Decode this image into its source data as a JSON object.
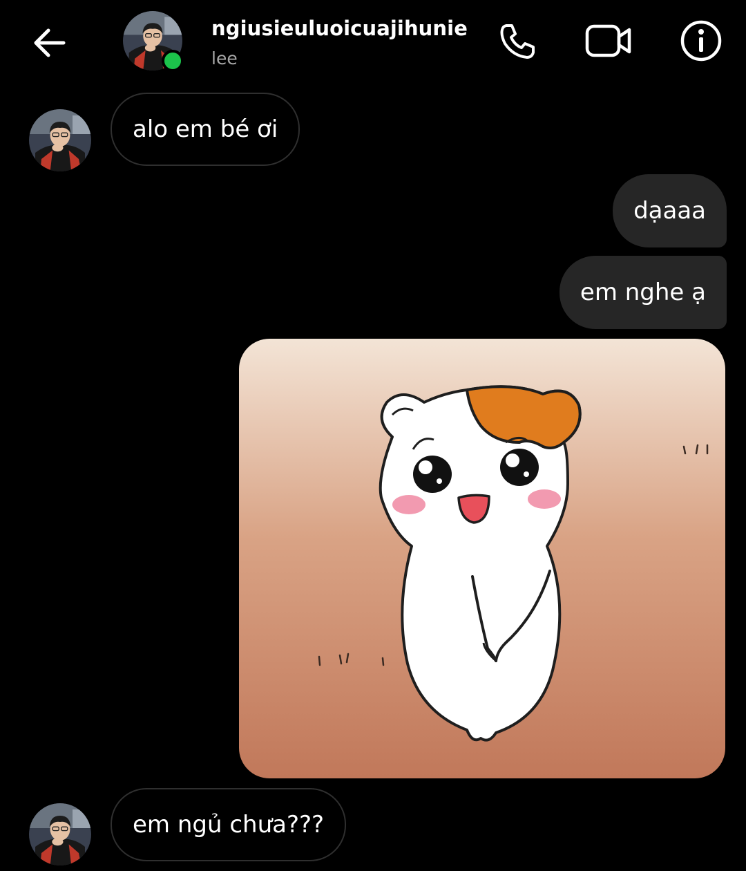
{
  "header": {
    "username": "ngiusieuluoicuajihunie",
    "subtitle": "lee",
    "icons": {
      "back": "arrow-left-icon",
      "call": "phone-icon",
      "video": "video-camera-icon",
      "info": "info-icon"
    },
    "online": true
  },
  "messages": [
    {
      "from": "them",
      "text": "alo em bé ơi"
    },
    {
      "from": "me",
      "text": "dạaaa"
    },
    {
      "from": "me",
      "text": "em nghe ạ"
    },
    {
      "from": "me",
      "type": "image",
      "image": "hamster-sticker"
    },
    {
      "from": "them",
      "text": "em ngủ chưa???"
    }
  ],
  "colors": {
    "background": "#000000",
    "outgoing_bubble": "#262626",
    "incoming_border": "#2f2f2f",
    "online": "#1cc34b",
    "subtitle": "#a8a8a8"
  }
}
